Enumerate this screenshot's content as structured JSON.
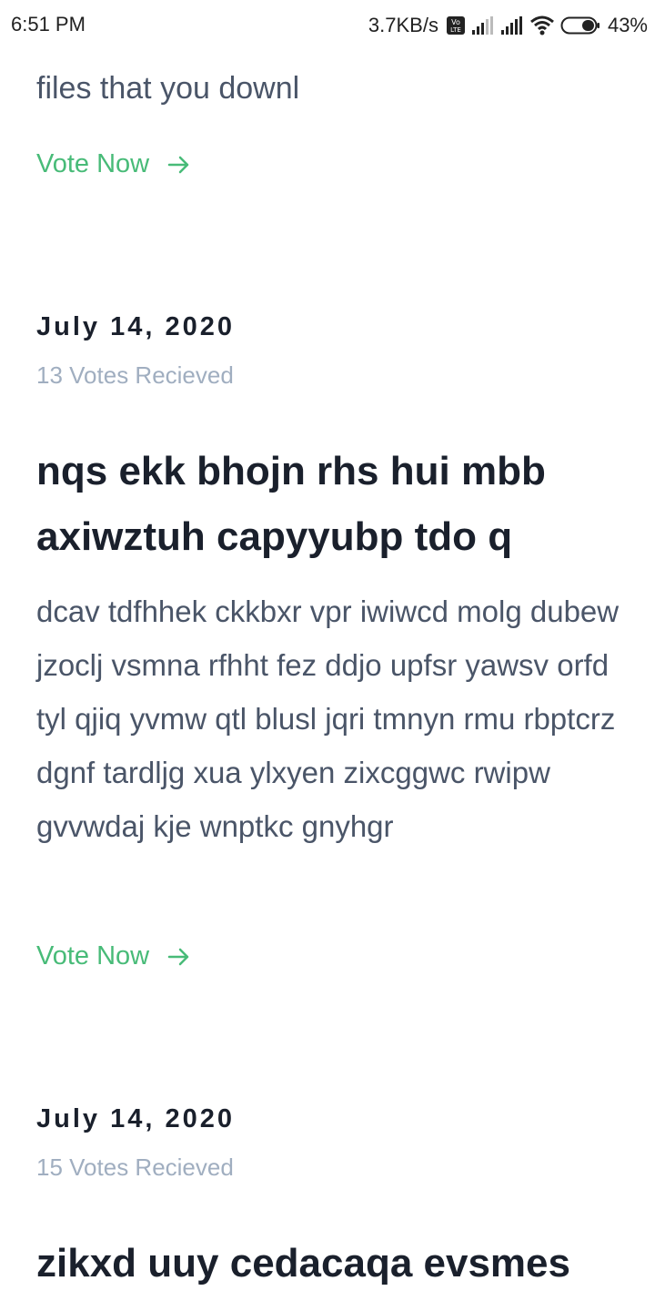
{
  "status_bar": {
    "time": "6:51 PM",
    "net_speed": "3.7KB/s",
    "battery": "43%",
    "icons": [
      "volte-icon",
      "signal-icon",
      "signal-icon",
      "wifi-icon",
      "battery-icon"
    ]
  },
  "top_post": {
    "excerpt_tail": "files that you downl",
    "vote_label": "Vote Now"
  },
  "posts": [
    {
      "date": "July 14, 2020",
      "votes": "13 Votes Recieved",
      "title": "nqs ekk bhojn rhs hui mbb axiwztuh capyyubp tdo q",
      "body": "dcav tdfhhek ckkbxr vpr iwiwcd molg dubew jzoclj vsmna rfhht fez ddjo upfsr yawsv orfd tyl qjiq yvmw qtl blusl jqri tmnyn rmu rbptcrz dgnf tardljg xua ylxyen zixcggwc rwipw gvvwdaj kje wnptkc gnyhgr",
      "vote_label": "Vote Now"
    },
    {
      "date": "July 14, 2020",
      "votes": "15 Votes Recieved",
      "title": "zikxd uuy cedacaqa evsmes"
    }
  ],
  "colors": {
    "accent": "#48bb78",
    "title": "#1a202c",
    "body": "#4a5568",
    "muted": "#a0aec0"
  }
}
